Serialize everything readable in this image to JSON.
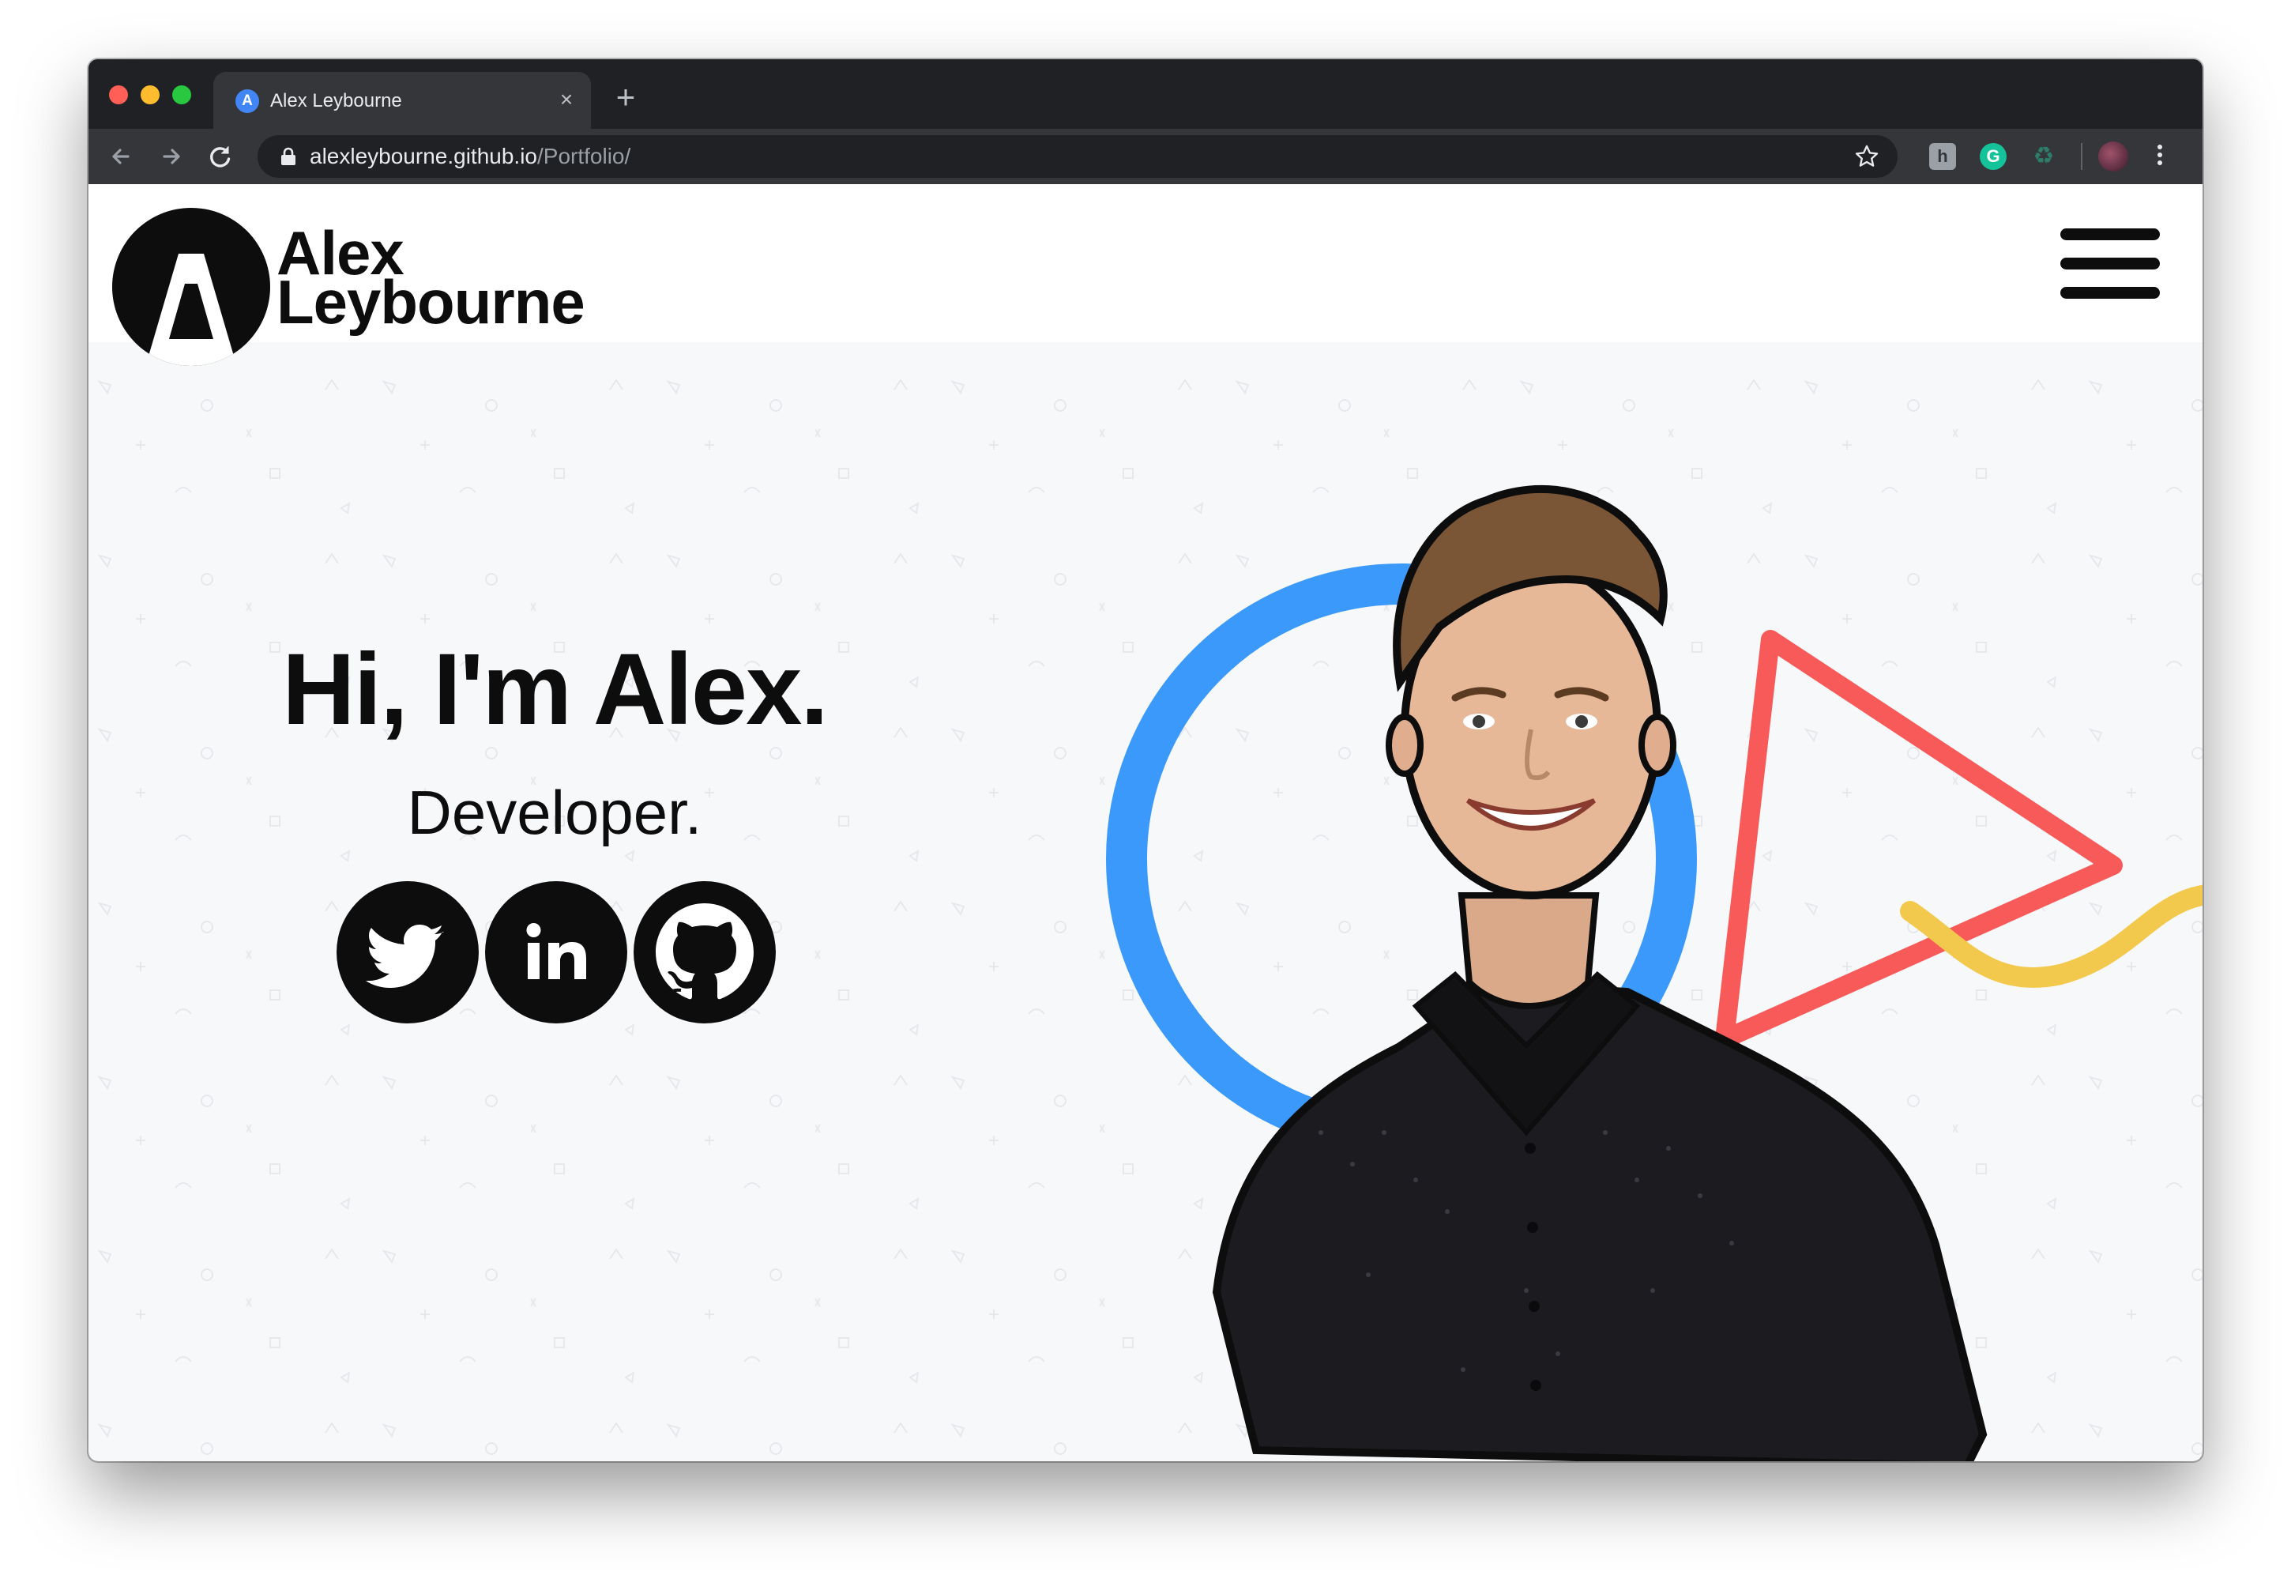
{
  "browser": {
    "tab_title": "Alex Leybourne",
    "tab_favicon_letter": "A",
    "new_tab_symbol": "+",
    "close_symbol": "×",
    "url_host": "alexleybourne.github.io",
    "url_path": "/Portfolio/",
    "extensions": [
      {
        "icon": "extension-icon",
        "glyph": "h"
      },
      {
        "icon": "grammarly-icon",
        "glyph": "G"
      },
      {
        "icon": "recycle-icon",
        "glyph": "♻"
      }
    ]
  },
  "site": {
    "logo_line1": "Alex",
    "logo_line2": "Leybourne",
    "hero_title": "Hi, I'm Alex.",
    "hero_subtitle": "Developer.",
    "socials": [
      {
        "name": "twitter",
        "icon": "twitter-icon"
      },
      {
        "name": "linkedin",
        "icon": "linkedin-icon",
        "label": "in"
      },
      {
        "name": "github",
        "icon": "github-icon"
      }
    ]
  },
  "colors": {
    "circle": "#3b99fc",
    "triangle": "#f85a5a",
    "squiggle": "#f2c94c",
    "ink": "#0d0d0d",
    "page_bg": "#f7f8fa"
  }
}
